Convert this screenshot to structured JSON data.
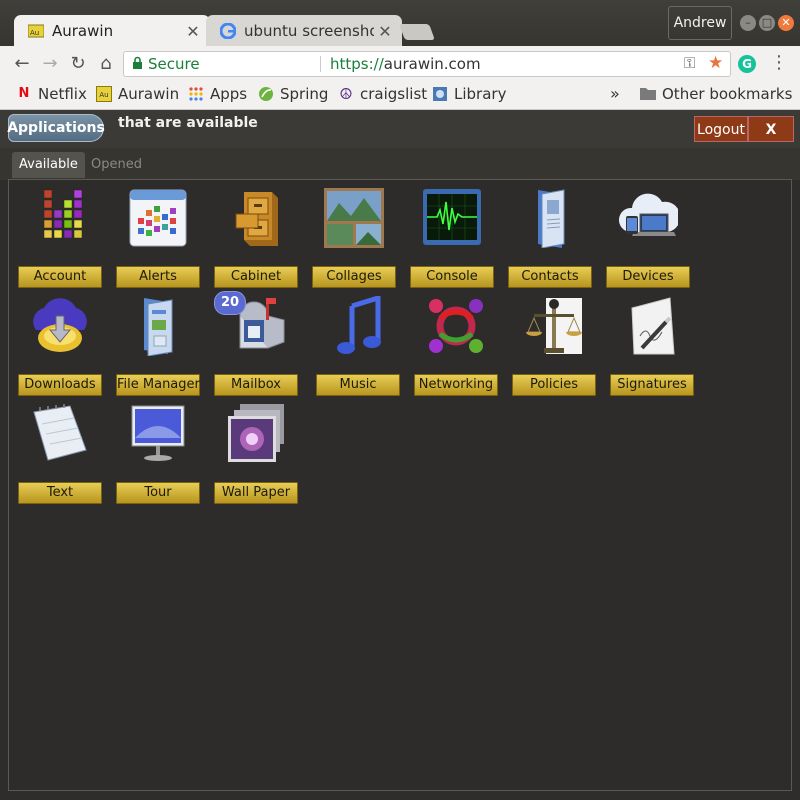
{
  "browser": {
    "tabs": [
      {
        "title": "Aurawin",
        "icon": "aurawin-favicon"
      },
      {
        "title": "ubuntu screenshot",
        "icon": "google-favicon"
      }
    ],
    "profile": "Andrew",
    "address": {
      "secure_label": "Secure",
      "scheme": "https://",
      "host": "aurawin.com"
    },
    "bookmarks": [
      {
        "label": "Netflix",
        "icon": "netflix-icon"
      },
      {
        "label": "Aurawin",
        "icon": "aurawin-icon"
      },
      {
        "label": "Apps",
        "icon": "apps-grid-icon"
      },
      {
        "label": "Spring",
        "icon": "spring-icon"
      },
      {
        "label": "craigslist",
        "icon": "peace-icon"
      },
      {
        "label": "Library",
        "icon": "library-icon"
      }
    ],
    "overflow": "»",
    "other_bookmarks": "Other bookmarks"
  },
  "header": {
    "applications_button": "Applications",
    "subtitle": "that are available",
    "logout": "Logout",
    "close": "X"
  },
  "subtabs": [
    "Available",
    "Opened"
  ],
  "apps": [
    {
      "label": "Account",
      "icon": "account-blocks-icon"
    },
    {
      "label": "Alerts",
      "icon": "alerts-calendar-icon"
    },
    {
      "label": "Cabinet",
      "icon": "file-cabinet-icon"
    },
    {
      "label": "Collages",
      "icon": "photo-collage-icon"
    },
    {
      "label": "Console",
      "icon": "console-monitor-icon"
    },
    {
      "label": "Contacts",
      "icon": "contacts-book-icon"
    },
    {
      "label": "Devices",
      "icon": "devices-cloud-icon"
    },
    {
      "label": "Downloads",
      "icon": "download-cloud-icon"
    },
    {
      "label": "File Manager",
      "icon": "file-manager-icon"
    },
    {
      "label": "Mailbox",
      "icon": "mailbox-icon"
    },
    {
      "label": "Music",
      "icon": "music-note-icon"
    },
    {
      "label": "Networking",
      "icon": "networking-people-icon"
    },
    {
      "label": "Policies",
      "icon": "scales-icon"
    },
    {
      "label": "Signatures",
      "icon": "signature-pen-icon"
    },
    {
      "label": "Text",
      "icon": "notepad-icon"
    },
    {
      "label": "Tour",
      "icon": "tour-screen-icon"
    },
    {
      "label": "Wall Paper",
      "icon": "wallpaper-icon"
    }
  ],
  "mailbox_badge": "20"
}
